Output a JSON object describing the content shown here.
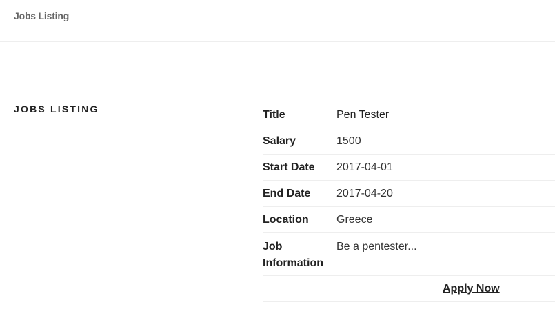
{
  "header": {
    "site_title": "Jobs Listing"
  },
  "main": {
    "section_heading": "JOBS LISTING"
  },
  "job": {
    "rows": [
      {
        "label": "Title",
        "value": "Pen Tester"
      },
      {
        "label": "Salary",
        "value": "1500"
      },
      {
        "label": "Start Date",
        "value": "2017-04-01"
      },
      {
        "label": "End Date",
        "value": "2017-04-20"
      },
      {
        "label": "Location",
        "value": "Greece"
      },
      {
        "label": "Job Information",
        "value": "Be a pentester..."
      }
    ],
    "apply_label": "Apply Now"
  }
}
